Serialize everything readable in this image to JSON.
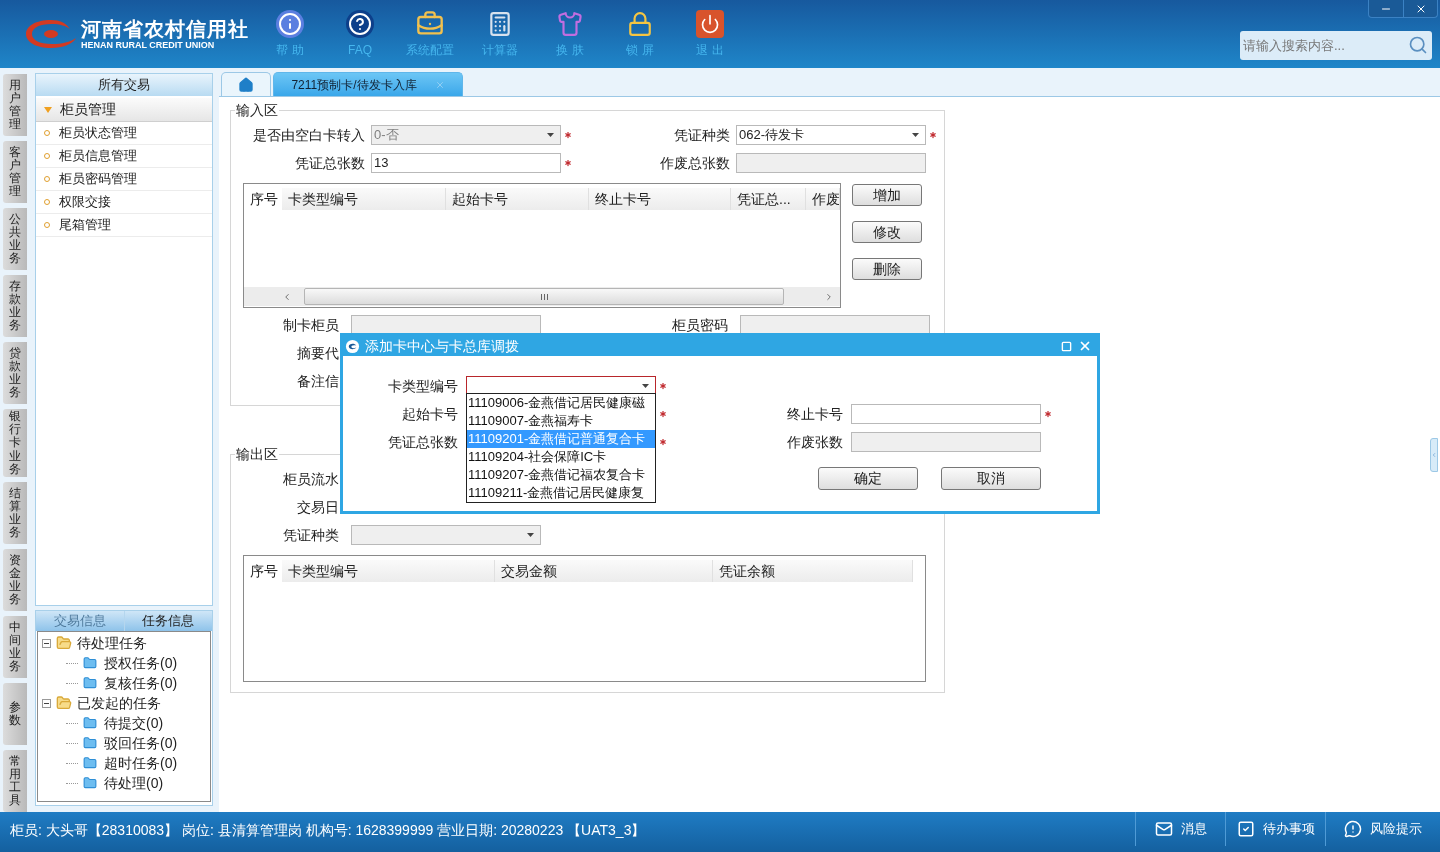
{
  "header": {
    "logo": {
      "name_cn": "河南省农村信用社",
      "name_en": "HENAN RURAL CREDIT UNION"
    },
    "toolbar": [
      {
        "kind": "help",
        "label": "帮 助"
      },
      {
        "kind": "faq",
        "label": "FAQ"
      },
      {
        "kind": "config",
        "label": "系统配置"
      },
      {
        "kind": "calculator",
        "label": "计算器"
      },
      {
        "kind": "skin",
        "label": "换 肤"
      },
      {
        "kind": "lock",
        "label": "锁 屏"
      },
      {
        "kind": "exit",
        "label": "退 出"
      }
    ],
    "search": {
      "placeholder": "请输入搜索内容..."
    }
  },
  "side_tabs": [
    "用户管理",
    "客户管理",
    "公共业务",
    "存款业务",
    "贷款业务",
    "银行卡业务",
    "结算业务",
    "资金业务",
    "中间业务",
    "参数",
    "常用工具"
  ],
  "sidebar": {
    "title": "所有交易",
    "group": {
      "label": "柜员管理",
      "expanded": true,
      "items": [
        "柜员状态管理",
        "柜员信息管理",
        "柜员密码管理",
        "权限交接",
        "尾箱管理"
      ]
    }
  },
  "task_panel": {
    "tabs": [
      {
        "label": "交易信息",
        "selected": false
      },
      {
        "label": "任务信息",
        "selected": true
      }
    ],
    "tree": [
      {
        "label": "待处理任务",
        "expanded": true,
        "children": [
          {
            "label": "授权任务(0)"
          },
          {
            "label": "复核任务(0)"
          }
        ]
      },
      {
        "label": "已发起的任务",
        "expanded": true,
        "children": [
          {
            "label": "待提交(0)"
          },
          {
            "label": "驳回任务(0)"
          },
          {
            "label": "超时任务(0)"
          },
          {
            "label": "待处理(0)"
          }
        ]
      }
    ]
  },
  "tabs": [
    {
      "kind": "home",
      "selected": false
    },
    {
      "kind": "page",
      "label": "7211预制卡/待发卡入库",
      "selected": true
    }
  ],
  "input_area": {
    "title": "输入区",
    "rows": [
      [
        {
          "label": "是否由空白卡转入",
          "kind": "select",
          "value": "0-否",
          "disabled": true,
          "required": true
        },
        {
          "label": "凭证种类",
          "kind": "select",
          "value": "062-待发卡",
          "disabled": false,
          "required": true
        }
      ],
      [
        {
          "label": "凭证总张数",
          "kind": "input",
          "value": "13",
          "disabled": false,
          "required": true
        },
        {
          "label": "作废总张数",
          "kind": "input",
          "disabled": true
        }
      ]
    ],
    "table": {
      "columns": [
        "序号",
        "卡类型编号",
        "起始卡号",
        "终止卡号",
        "凭证总...",
        "作废"
      ]
    },
    "buttons": [
      "增加",
      "修改",
      "删除"
    ],
    "more_rows": [
      [
        {
          "label": "制卡柜员",
          "kind": "input",
          "disabled": true
        },
        {
          "label": "柜员密码",
          "kind": "input",
          "disabled": true
        }
      ],
      [
        {
          "label": "摘要代",
          "kind": "hidden"
        }
      ],
      [
        {
          "label": "备注信",
          "kind": "hidden"
        }
      ]
    ]
  },
  "output_area": {
    "title": "输出区",
    "rows": [
      [
        {
          "label": "柜员流水",
          "kind": "hidden"
        }
      ],
      [
        {
          "label": "交易日",
          "kind": "hidden"
        }
      ],
      [
        {
          "label": "凭证种类",
          "kind": "select",
          "disabled": true
        }
      ]
    ],
    "table": {
      "columns": [
        "序号",
        "卡类型编号",
        "交易金额",
        "凭证余额"
      ]
    }
  },
  "dialog": {
    "title": "添加卡中心与卡总库调拨",
    "rows": [
      [
        {
          "label": "卡类型编号",
          "kind": "select",
          "focused": true,
          "disabled": false,
          "required": true
        }
      ],
      [
        {
          "label": "起始卡号",
          "kind": "hidden",
          "required": true
        },
        {
          "label": "终止卡号",
          "kind": "input",
          "disabled": false,
          "required": true
        }
      ],
      [
        {
          "label": "凭证总张数",
          "kind": "hidden",
          "required": true
        },
        {
          "label": "作废张数",
          "kind": "input",
          "disabled": true
        }
      ]
    ],
    "options": [
      {
        "label": "11109006-金燕借记居民健康磁",
        "selected": false
      },
      {
        "label": "11109007-金燕福寿卡",
        "selected": false
      },
      {
        "label": "11109201-金燕借记普通复合卡",
        "selected": true
      },
      {
        "label": "11109204-社会保障IC卡",
        "selected": false
      },
      {
        "label": "11109207-金燕借记福农复合卡",
        "selected": false
      },
      {
        "label": "11109211-金燕借记居民健康复",
        "selected": false
      }
    ],
    "buttons": [
      "确定",
      "取消"
    ]
  },
  "status_bar": {
    "text": "柜员: 大头哥【28310083】 岗位: 县清算管理岗 机构号: 1628399999 营业日期: 20280223 【UAT3_3】",
    "items": [
      {
        "kind": "message",
        "label": "消息"
      },
      {
        "kind": "todo",
        "label": "待办事项"
      },
      {
        "kind": "risk",
        "label": "风险提示"
      }
    ]
  }
}
